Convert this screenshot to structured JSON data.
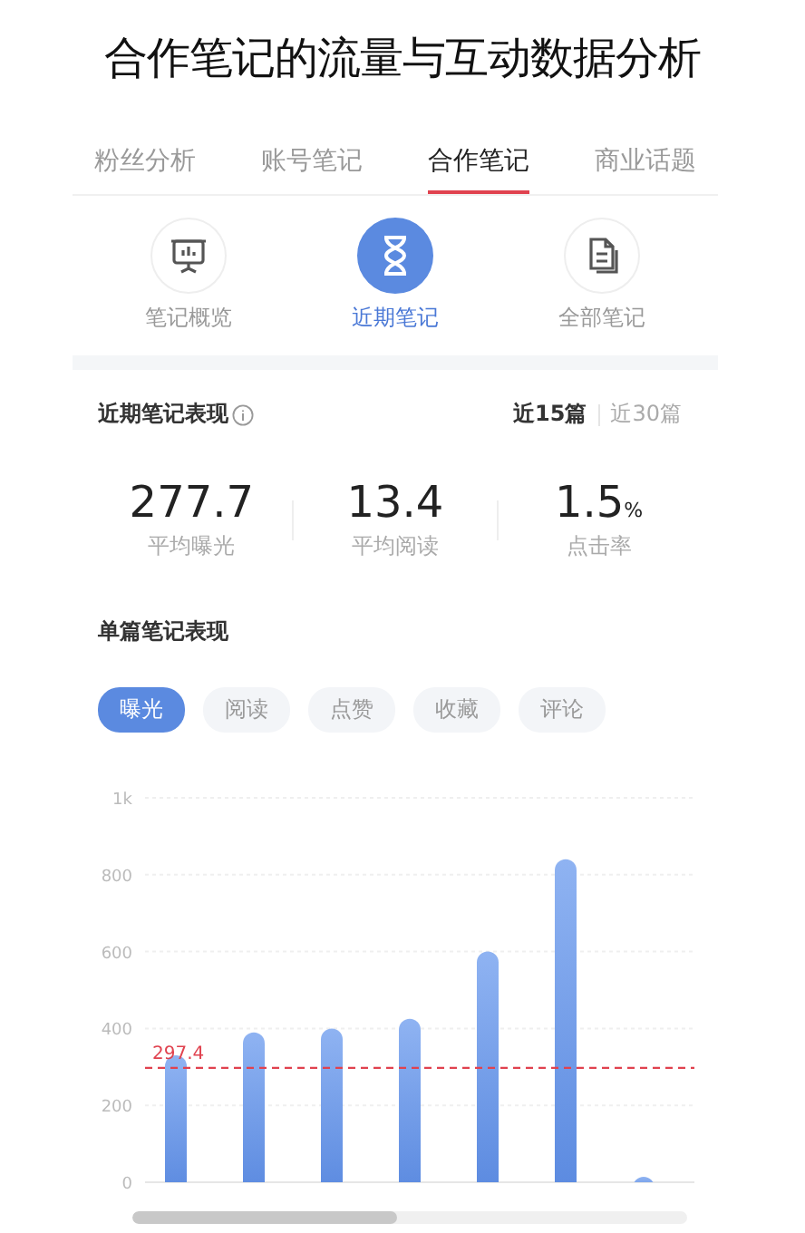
{
  "title": "合作笔记的流量与互动数据分析",
  "tabs": [
    {
      "label": "粉丝分析",
      "selected": false
    },
    {
      "label": "账号笔记",
      "selected": false
    },
    {
      "label": "合作笔记",
      "selected": true
    },
    {
      "label": "商业话题",
      "selected": false
    }
  ],
  "subtabs": [
    {
      "label": "笔记概览",
      "kind": "board",
      "selected": false
    },
    {
      "label": "近期笔记",
      "kind": "hourglass",
      "selected": true
    },
    {
      "label": "全部笔记",
      "kind": "document",
      "selected": false
    }
  ],
  "recent": {
    "title": "近期笔记表现",
    "ranges": [
      {
        "label": "近15篇",
        "selected": true
      },
      {
        "label": "近30篇",
        "selected": false
      }
    ],
    "stats": [
      {
        "value": "277.7",
        "label": "平均曝光"
      },
      {
        "value": "13.4",
        "label": "平均阅读"
      },
      {
        "value": "1.5",
        "unit": "%",
        "label": "点击率"
      }
    ]
  },
  "single": {
    "title": "单篇笔记表现",
    "chips": [
      {
        "label": "曝光",
        "selected": true
      },
      {
        "label": "阅读",
        "selected": false
      },
      {
        "label": "点赞",
        "selected": false
      },
      {
        "label": "收藏",
        "selected": false
      },
      {
        "label": "评论",
        "selected": false
      }
    ],
    "chart_data": {
      "type": "bar",
      "series": [
        {
          "color": "#5b8ae0",
          "values": [
            330,
            390,
            400,
            425,
            600,
            840,
            14
          ]
        }
      ],
      "ylim": [
        0,
        1000
      ],
      "yticks": [
        0,
        200,
        400,
        600,
        800,
        {
          "value": 1000,
          "label": "1k"
        }
      ],
      "grid": true,
      "ref_lines": [
        {
          "axis": "y",
          "value": 297.4,
          "label": "297.4",
          "color": "#e0424f"
        }
      ]
    }
  }
}
